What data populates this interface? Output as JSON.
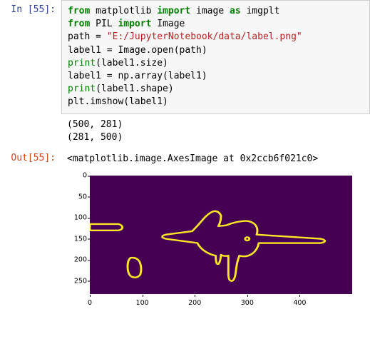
{
  "prompts": {
    "in": "In [55]:",
    "out": "Out[55]:"
  },
  "code": {
    "l1_from": "from",
    "l1_mpl": " matplotlib ",
    "l1_import": "import",
    "l1_img": " image ",
    "l1_as": "as",
    "l1_alias": " imgplt",
    "l2_from": "from",
    "l2_pil": " PIL ",
    "l2_import": "import",
    "l2_image": " Image",
    "l3_a": "path = ",
    "l3_str": "\"E:/JupyterNotebook/data/label.png\"",
    "l4": "label1 = Image.open(path)",
    "l5_print": "print",
    "l5_rest": "(label1.size)",
    "l6": "label1 = np.array(label1)",
    "l7_print": "print",
    "l7_rest": "(label1.shape)",
    "l8": "plt.imshow(label1)"
  },
  "stdout": {
    "line1": "(500, 281)",
    "line2": "(281, 500)"
  },
  "result": "<matplotlib.image.AxesImage at 0x2ccb6f021c0>",
  "chart_data": {
    "type": "image",
    "xlabel": "",
    "ylabel": "",
    "xlim": [
      0,
      499
    ],
    "ylim": [
      280,
      0
    ],
    "xticks": [
      0,
      100,
      200,
      300,
      400
    ],
    "yticks": [
      0,
      50,
      100,
      150,
      200,
      250
    ],
    "description": "imshow of a label mask: dark purple background (value 0) with thin yellow (value 1) contour outlines of an airplane silhouette and a few small blobs; image dimensions 500x281."
  }
}
